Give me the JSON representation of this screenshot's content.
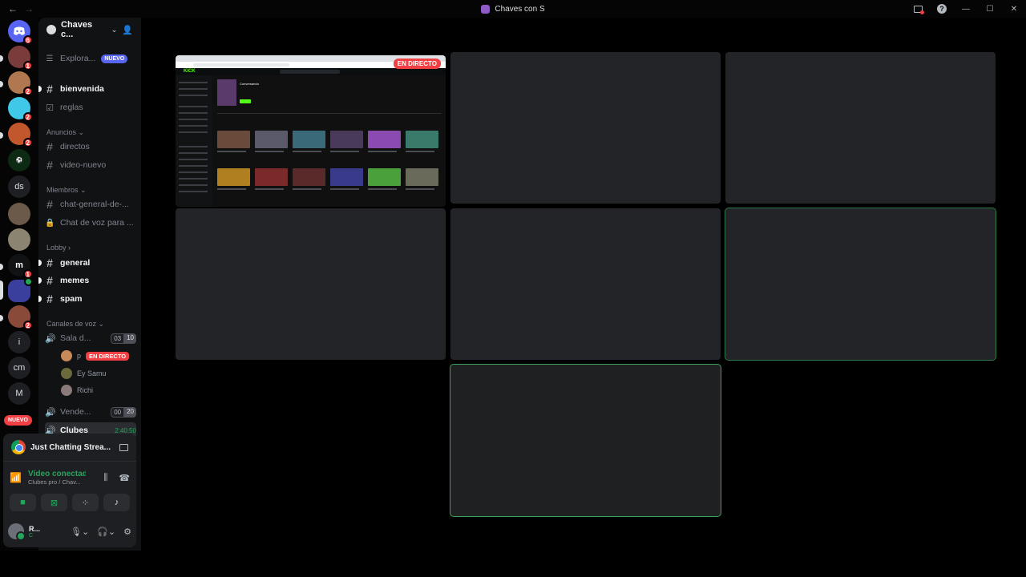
{
  "window": {
    "title": "Chaves con S"
  },
  "rail": {
    "servers": [
      {
        "label": "",
        "badge": "6"
      },
      {
        "label": "",
        "badge": "1"
      },
      {
        "label": "",
        "badge": "2"
      },
      {
        "label": "",
        "badge": "2"
      },
      {
        "label": "",
        "badge": "2"
      },
      {
        "label": "",
        "badge": ""
      },
      {
        "label": "ds",
        "badge": ""
      },
      {
        "label": "",
        "badge": ""
      },
      {
        "label": "",
        "badge": ""
      },
      {
        "label": "",
        "badge": "1"
      },
      {
        "label": "",
        "badge": ""
      },
      {
        "label": "",
        "badge": "2"
      },
      {
        "label": "i",
        "badge": ""
      },
      {
        "label": "cm",
        "badge": ""
      },
      {
        "label": "M",
        "badge": ""
      }
    ],
    "nuevo": "NUEVO"
  },
  "guild": {
    "name": "Chaves c...",
    "explore": "Explora...",
    "explore_badge": "NUEVO"
  },
  "channels": {
    "bienvenida": "bienvenida",
    "reglas": "reglas",
    "cat_anuncios": "Anuncios",
    "directos": "directos",
    "video_nuevo": "video-nuevo",
    "cat_miembros": "Miembros",
    "chat_general": "chat-general-de-...",
    "chat_voz": "Chat de voz para ...",
    "cat_lobby": "Lobby",
    "general": "general",
    "memes": "memes",
    "spam": "spam",
    "cat_voz": "Canales de voz",
    "sala": "Sala d...",
    "sala_count_a": "03",
    "sala_count_b": "10",
    "user_p": "p",
    "live_label": "EN DIRECTO",
    "user_ey": "Ey Samu",
    "user_richi": "Richi",
    "vende": "Vende...",
    "vende_count_a": "00",
    "vende_count_b": "20",
    "clubes": "Clubes",
    "clubes_time": "2:40:50"
  },
  "panel": {
    "stream_title": "Just Chatting Strea...",
    "voice_status": "Vídeo conectad",
    "voice_sub": "Clubes pro / Chav...",
    "user_name": "R...",
    "user_status": "C"
  },
  "stage": {
    "live_badge": "EN DIRECTO",
    "stream_logo": "KICK",
    "stream_channel": "Conversando"
  }
}
